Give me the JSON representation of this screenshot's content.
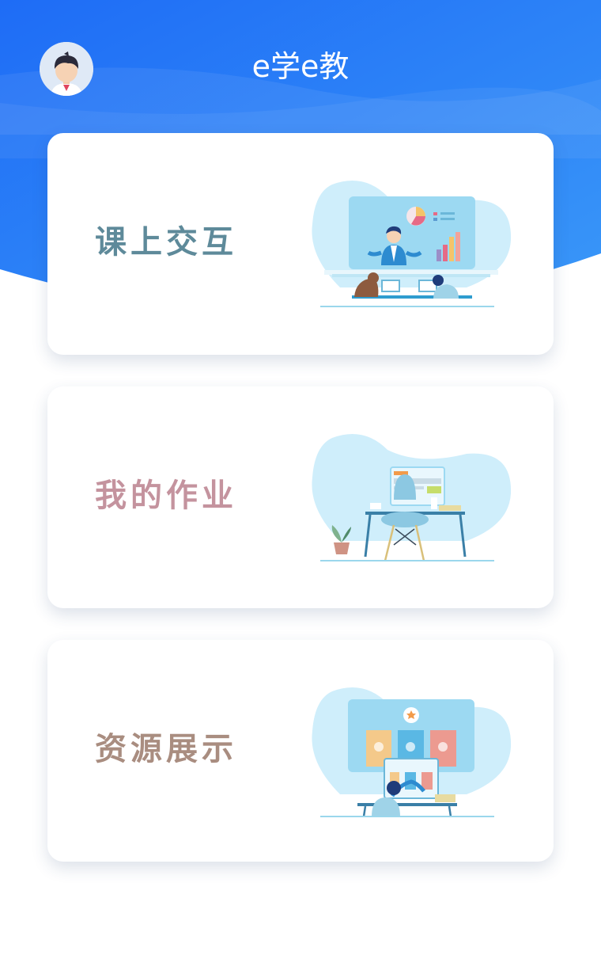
{
  "header": {
    "app_title": "e学e教",
    "avatar_icon": "user-avatar-icon",
    "gradient_colors": [
      "#1f6ff6",
      "#3c93f7"
    ]
  },
  "cards": [
    {
      "title": "课上交互",
      "color": "#5e8a9a",
      "illustration": "classroom-interaction-illustration"
    },
    {
      "title": "我的作业",
      "color": "#c4939e",
      "illustration": "homework-desk-illustration"
    },
    {
      "title": "资源展示",
      "color": "#a98d80",
      "illustration": "resource-display-illustration"
    }
  ]
}
